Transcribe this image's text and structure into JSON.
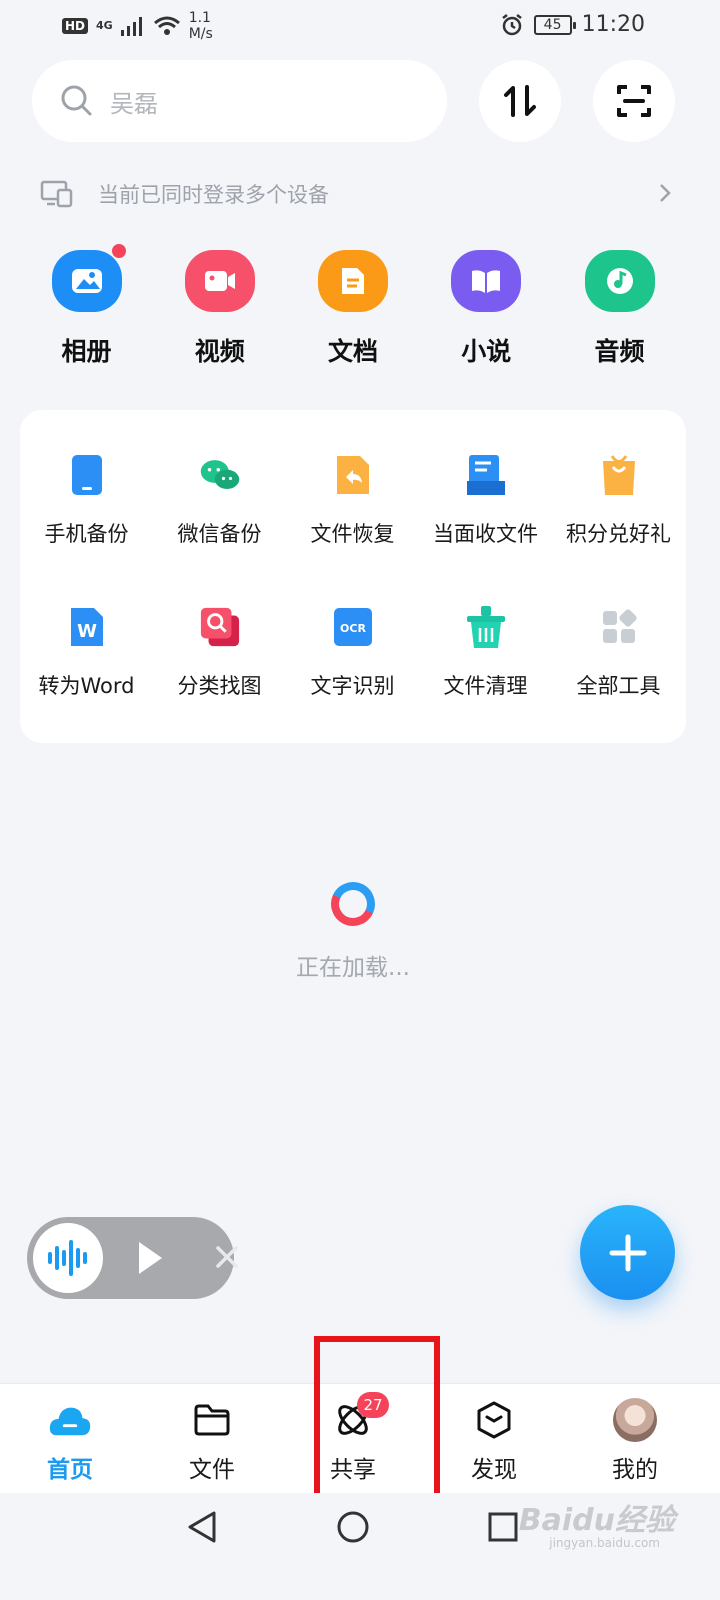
{
  "status_bar": {
    "hd": "HD",
    "network": "4G",
    "speed_value": "1.1",
    "speed_unit": "M/s",
    "battery": "45",
    "time": "11:20"
  },
  "search": {
    "placeholder": "吴磊"
  },
  "device_notice": "当前已同时登录多个设备",
  "categories": [
    {
      "label": "相册",
      "icon": "album-icon",
      "color": "#1e8ef7"
    },
    {
      "label": "视频",
      "icon": "video-icon",
      "color": "#f6506a"
    },
    {
      "label": "文档",
      "icon": "document-icon",
      "color": "#fb9a17"
    },
    {
      "label": "小说",
      "icon": "novel-icon",
      "color": "#7b5cf0"
    },
    {
      "label": "音频",
      "icon": "audio-icon",
      "color": "#1dc48c"
    }
  ],
  "tools": [
    {
      "label": "手机备份",
      "icon": "phone-backup-icon"
    },
    {
      "label": "微信备份",
      "icon": "wechat-backup-icon"
    },
    {
      "label": "文件恢复",
      "icon": "file-restore-icon"
    },
    {
      "label": "当面收文件",
      "icon": "receive-file-icon"
    },
    {
      "label": "积分兑好礼",
      "icon": "points-gift-icon"
    },
    {
      "label": "转为Word",
      "icon": "convert-word-icon"
    },
    {
      "label": "分类找图",
      "icon": "find-image-icon"
    },
    {
      "label": "文字识别",
      "icon": "ocr-icon"
    },
    {
      "label": "文件清理",
      "icon": "file-clean-icon"
    },
    {
      "label": "全部工具",
      "icon": "all-tools-icon"
    }
  ],
  "ocr_icon_text": "OCR",
  "word_icon_text": "W",
  "loading_text": "正在加载...",
  "bottom_nav": [
    {
      "label": "首页",
      "icon": "home-cloud-icon",
      "active": true
    },
    {
      "label": "文件",
      "icon": "folder-icon"
    },
    {
      "label": "共享",
      "icon": "share-orbit-icon",
      "badge": "27"
    },
    {
      "label": "发现",
      "icon": "discover-icon"
    },
    {
      "label": "我的",
      "icon": "avatar-icon"
    }
  ],
  "watermark": "Baidu经验",
  "watermark_sub": "jingyan.baidu.com"
}
